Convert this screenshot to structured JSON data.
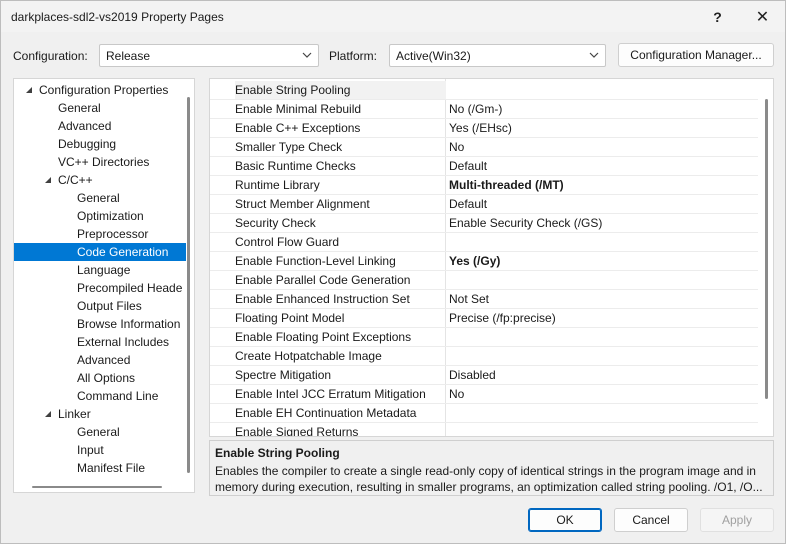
{
  "window": {
    "title": "darkplaces-sdl2-vs2019 Property Pages"
  },
  "titlebar": {
    "help_label": "?",
    "close_label": "✕"
  },
  "config": {
    "configuration_label": "Configuration:",
    "configuration_value": "Release",
    "platform_label": "Platform:",
    "platform_value": "Active(Win32)",
    "manager_label": "Configuration Manager..."
  },
  "tree": {
    "items": [
      {
        "label": "Configuration Properties",
        "level": 0,
        "expanded": true
      },
      {
        "label": "General",
        "level": 1
      },
      {
        "label": "Advanced",
        "level": 1
      },
      {
        "label": "Debugging",
        "level": 1
      },
      {
        "label": "VC++ Directories",
        "level": 1
      },
      {
        "label": "C/C++",
        "level": 1,
        "expanded": true
      },
      {
        "label": "General",
        "level": 2
      },
      {
        "label": "Optimization",
        "level": 2
      },
      {
        "label": "Preprocessor",
        "level": 2
      },
      {
        "label": "Code Generation",
        "level": 2,
        "selected": true
      },
      {
        "label": "Language",
        "level": 2
      },
      {
        "label": "Precompiled Heade",
        "level": 2
      },
      {
        "label": "Output Files",
        "level": 2
      },
      {
        "label": "Browse Information",
        "level": 2
      },
      {
        "label": "External Includes",
        "level": 2
      },
      {
        "label": "Advanced",
        "level": 2
      },
      {
        "label": "All Options",
        "level": 2
      },
      {
        "label": "Command Line",
        "level": 2
      },
      {
        "label": "Linker",
        "level": 1,
        "expanded": true
      },
      {
        "label": "General",
        "level": 2
      },
      {
        "label": "Input",
        "level": 2
      },
      {
        "label": "Manifest File",
        "level": 2
      }
    ]
  },
  "grid": {
    "rows": [
      {
        "name": "Enable String Pooling",
        "value": "",
        "selected": true
      },
      {
        "name": "Enable Minimal Rebuild",
        "value": "No (/Gm-)"
      },
      {
        "name": "Enable C++ Exceptions",
        "value": "Yes (/EHsc)"
      },
      {
        "name": "Smaller Type Check",
        "value": "No"
      },
      {
        "name": "Basic Runtime Checks",
        "value": "Default"
      },
      {
        "name": "Runtime Library",
        "value": "Multi-threaded (/MT)",
        "bold": true
      },
      {
        "name": "Struct Member Alignment",
        "value": "Default"
      },
      {
        "name": "Security Check",
        "value": "Enable Security Check (/GS)"
      },
      {
        "name": "Control Flow Guard",
        "value": ""
      },
      {
        "name": "Enable Function-Level Linking",
        "value": "Yes (/Gy)",
        "bold": true
      },
      {
        "name": "Enable Parallel Code Generation",
        "value": ""
      },
      {
        "name": "Enable Enhanced Instruction Set",
        "value": "Not Set"
      },
      {
        "name": "Floating Point Model",
        "value": "Precise (/fp:precise)"
      },
      {
        "name": "Enable Floating Point Exceptions",
        "value": ""
      },
      {
        "name": "Create Hotpatchable Image",
        "value": ""
      },
      {
        "name": "Spectre Mitigation",
        "value": "Disabled"
      },
      {
        "name": "Enable Intel JCC Erratum Mitigation",
        "value": "No"
      },
      {
        "name": "Enable EH Continuation Metadata",
        "value": ""
      },
      {
        "name": "Enable Signed Returns",
        "value": ""
      }
    ]
  },
  "description": {
    "title": "Enable String Pooling",
    "text": "Enables the compiler to create a single read-only copy of identical strings in the program image and in memory during execution, resulting in smaller programs, an optimization called string pooling. /O1, /O..."
  },
  "buttons": {
    "ok": "OK",
    "cancel": "Cancel",
    "apply": "Apply"
  },
  "colors": {
    "selection": "#0078d4",
    "accent_border": "#0067c0"
  }
}
